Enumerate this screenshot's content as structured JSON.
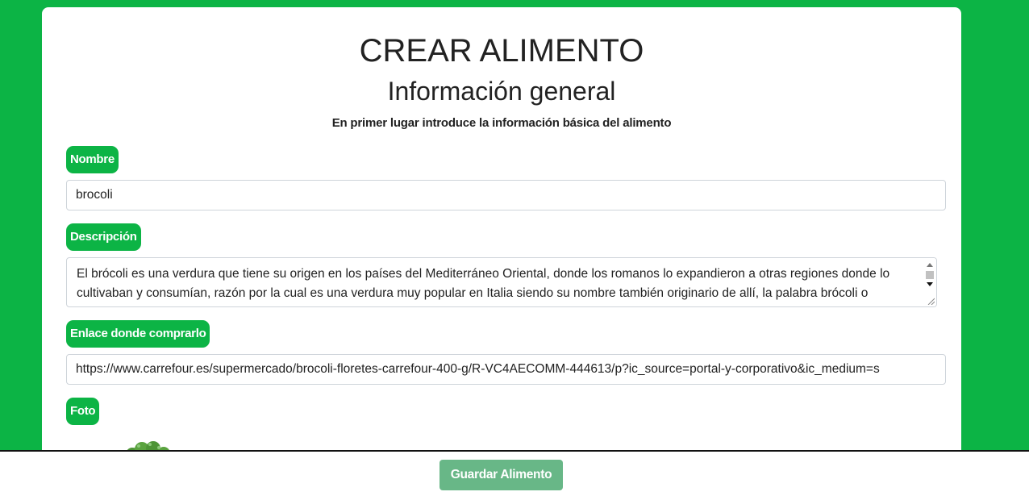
{
  "form": {
    "title": "CREAR ALIMENTO",
    "subtitle": "Información general",
    "intro": "En primer lugar introduce la información básica del alimento",
    "name_label": "Nombre",
    "name_value": "brocoli",
    "description_label": "Descripción",
    "description_value": "El brócoli es una verdura que tiene su origen en los países del Mediterráneo Oriental, donde los romanos lo expandieron a otras regiones donde lo cultivaban y consumían, razón por la cual es una verdura muy popular en Italia siendo su nombre también originario de allí, la palabra brócoli o bróculo es el nombre italiano de la flor de la col, que significa brote.",
    "link_label": "Enlace donde comprarlo",
    "link_value": "https://www.carrefour.es/supermercado/brocoli-floretes-carrefour-400-g/R-VC4AECOMM-444613/p?ic_source=portal-y-corporativo&ic_medium=s",
    "photo_label": "Foto"
  },
  "footer": {
    "save_label": "Guardar Alimento"
  },
  "colors": {
    "brand_green": "#0cb445",
    "save_button": "#68b787"
  },
  "icons": {
    "scroll_up": "arrow-up-icon",
    "scroll_down": "arrow-down-icon",
    "resize": "resize-grip-icon"
  }
}
